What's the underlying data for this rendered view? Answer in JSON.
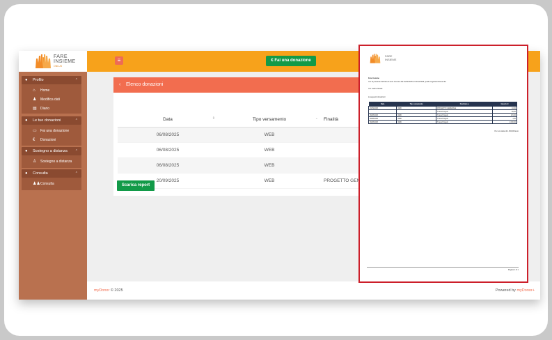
{
  "logo": {
    "line1": "FARE",
    "line2": "INSIEME",
    "tag": "ONLUS"
  },
  "sidebar": {
    "sections": [
      {
        "label": "Profilo",
        "items": [
          {
            "label": "Home"
          },
          {
            "label": "Modifica dati"
          },
          {
            "label": "Diario"
          }
        ]
      },
      {
        "label": "Le tue donazioni",
        "items": [
          {
            "label": "Fai una donazione"
          },
          {
            "label": "Donazioni"
          }
        ]
      },
      {
        "label": "Sostegno a distanza",
        "items": [
          {
            "label": "Sostegno a distanza"
          }
        ]
      },
      {
        "label": "Consulta",
        "items": [
          {
            "label": "Consulta"
          }
        ]
      }
    ]
  },
  "topbar": {
    "menu_icon": "≡",
    "donate_label": "€ Fai una donazione"
  },
  "panel": {
    "title": "Elenco donazioni",
    "columns": [
      "Data",
      "Tipo versamento",
      "Finalità"
    ],
    "rows": [
      {
        "data": "06/08/2025",
        "tipo": "WEB",
        "finalita": ""
      },
      {
        "data": "06/08/2025",
        "tipo": "WEB",
        "finalita": ""
      },
      {
        "data": "06/08/2025",
        "tipo": "WEB",
        "finalita": ""
      },
      {
        "data": "20/09/2025",
        "tipo": "WEB",
        "finalita": "PROGETTO GENE"
      }
    ],
    "report_label": "Scarica report"
  },
  "footer": {
    "brand": "myDonor",
    "copy": "© 2025",
    "powered": "Powered by",
    "powered_brand": "myDonor+"
  },
  "pdf": {
    "org": "Fare Insieme",
    "intro": "con la presente dichiara di aver ricevuto dal 01/01/2025 al 31/12/2025, quali erogazioni liberali da",
    "fiscal": "con codice fiscale",
    "following": "le seguenti donazioni:",
    "columns": [
      "Data",
      "Tipo versamento",
      "Destinato a",
      "Importo €"
    ],
    "rows": [
      [
        "20/09/2025",
        "WEB",
        "PROGETTO GENERALE",
        "10,00"
      ],
      [
        "",
        "",
        "Tutela Progetti",
        "50,00"
      ],
      [
        "06/08/2025",
        "WEB",
        "Tutela Progetti",
        "115,00"
      ],
      [
        "06/08/2025",
        "WEB",
        "Tutela Progetti",
        "1,00"
      ],
      [
        "06/08/2025",
        "WEB",
        "Tutela Progetti",
        "1.000,00"
      ]
    ],
    "total": "Per un totale di 1.150,00 Euro",
    "page": "Pagina 1 di 1"
  },
  "colors": {
    "topbar": "#f7a21b",
    "sidebar": "#b9714f",
    "accent": "#f26d4f",
    "button": "#129a48",
    "highlight": "#cc1f2a"
  }
}
